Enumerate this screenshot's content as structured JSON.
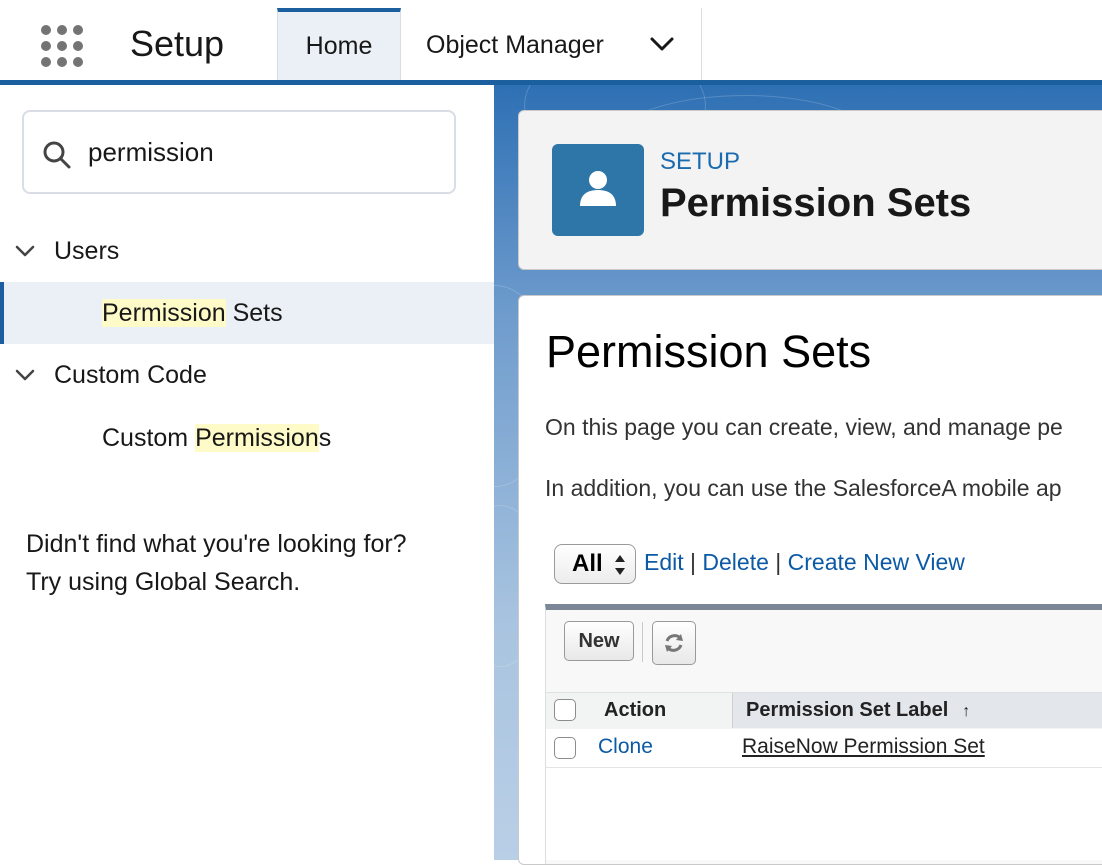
{
  "global_nav": {
    "app_name": "Setup",
    "tabs": [
      {
        "label": "Home",
        "active": true
      },
      {
        "label": "Object Manager",
        "has_dropdown": true
      }
    ],
    "accent_color": "#1b5f9e"
  },
  "sidebar": {
    "search": {
      "value": "permission",
      "placeholder": "Quick Find"
    },
    "tree": [
      {
        "label": "Users",
        "expanded": true,
        "children": [
          {
            "label_highlight": "Permission",
            "label_rest": " Sets",
            "selected": true
          }
        ]
      },
      {
        "label": "Custom Code",
        "expanded": true,
        "children": [
          {
            "label_prefix": "Custom ",
            "label_highlight": "Permission",
            "label_rest": "s"
          }
        ]
      }
    ],
    "not_found_line1": "Didn't find what you're looking for?",
    "not_found_line2": "Try using Global Search."
  },
  "page_header": {
    "eyebrow": "SETUP",
    "title": "Permission Sets",
    "icon": "user-icon",
    "icon_bg": "#2e76a7"
  },
  "content": {
    "title": "Permission Sets",
    "para1": "On this page you can create, view, and manage pe",
    "para2": "In addition, you can use the SalesforceA mobile ap",
    "view_select": {
      "value": "All"
    },
    "view_links": {
      "edit": "Edit",
      "delete": "Delete",
      "create": "Create New View",
      "separator": "|"
    },
    "toolbar": {
      "new_label": "New",
      "refresh_icon": "refresh-icon"
    },
    "table": {
      "columns": [
        "Action",
        "Permission Set Label"
      ],
      "sort_indicator": "↑",
      "rows": [
        {
          "action": "Clone",
          "label": "RaiseNow Permission Set"
        }
      ]
    },
    "link_color": "#0c5aa6"
  }
}
